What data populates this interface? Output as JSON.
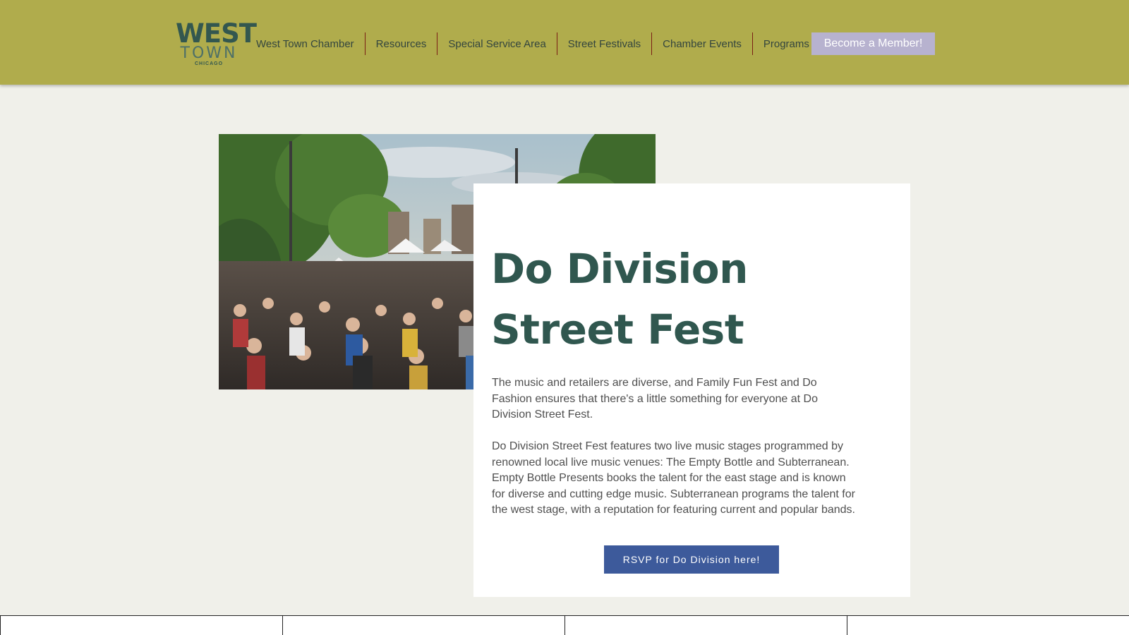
{
  "header": {
    "logo": {
      "line1": "WEST",
      "line2": "TOWN",
      "line3": "CHICAGO"
    },
    "nav": [
      {
        "label": "West Town Chamber"
      },
      {
        "label": "Resources"
      },
      {
        "label": "Special Service Area"
      },
      {
        "label": "Street Festivals"
      },
      {
        "label": "Chamber Events"
      },
      {
        "label": "Programs"
      }
    ],
    "member_button": "Become a Member!"
  },
  "hero": {
    "image_name": "street-festival-crowd-photo"
  },
  "card": {
    "title_line1": "Do Division",
    "title_line2": "Street Fest",
    "paragraph1": "The music and retailers are diverse, and Family Fun Fest and Do Fashion ensures that there's a little something for everyone at Do Division Street Fest.",
    "paragraph2": "Do Division Street Fest features two live music stages programmed by renowned local live music venues: The Empty Bottle and Subterranean. Empty Bottle Presents books the talent for the east stage and is known for diverse and cutting edge music. Subterranean programs the talent for the west stage, with a reputation for featuring current and popular bands.",
    "rsvp_button": "RSVP for Do Division here!"
  },
  "colors": {
    "header_bg": "#b0ac4c",
    "page_bg": "#f0f0ea",
    "title": "#30574f",
    "member_button": "#b7b2cf",
    "rsvp_button": "#3d5a9b"
  }
}
